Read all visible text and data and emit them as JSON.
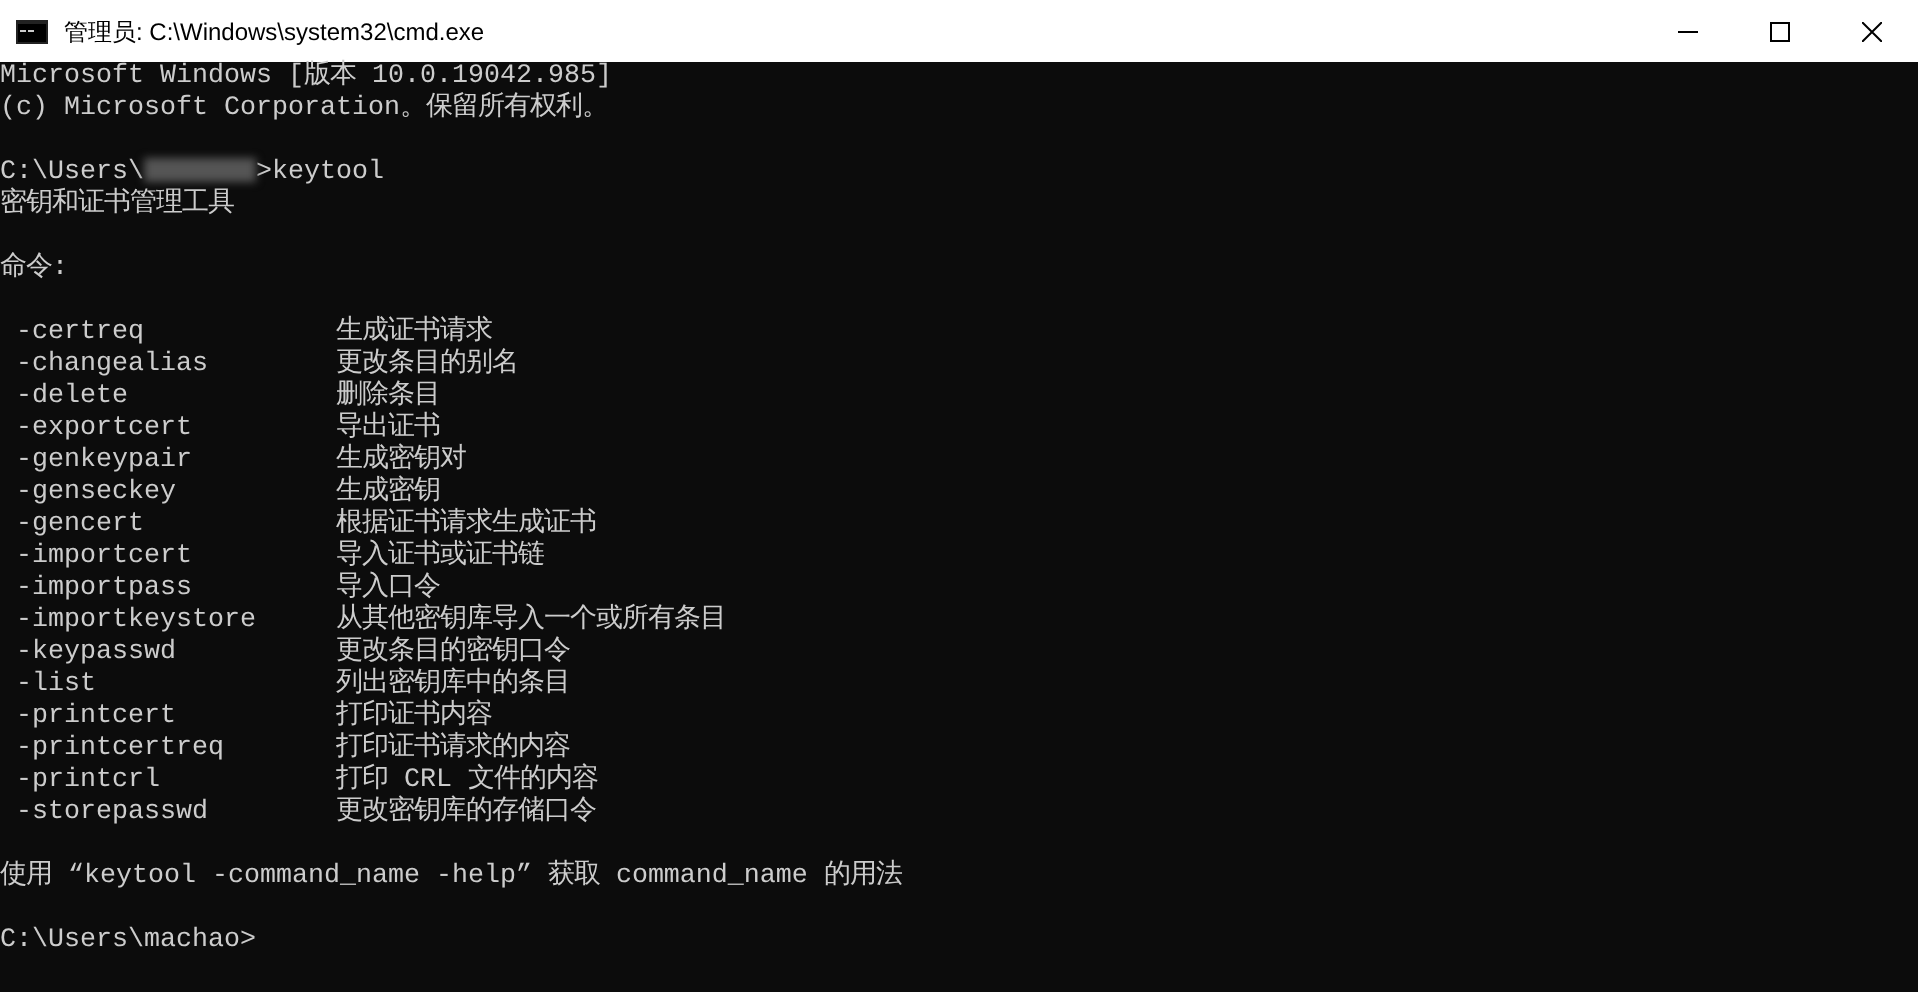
{
  "window": {
    "title": "管理员: C:\\Windows\\system32\\cmd.exe"
  },
  "console": {
    "header": [
      "Microsoft Windows [版本 10.0.19042.985]",
      "(c) Microsoft Corporation。保留所有权利。"
    ],
    "command_line": {
      "prompt_prefix": "C:\\Users\\",
      "command": ">keytool"
    },
    "tool_title": "密钥和证书管理工具",
    "commands_heading": "命令:",
    "commands": [
      {
        "name": "-certreq",
        "description": "生成证书请求"
      },
      {
        "name": "-changealias",
        "description": "更改条目的别名"
      },
      {
        "name": "-delete",
        "description": "删除条目"
      },
      {
        "name": "-exportcert",
        "description": "导出证书"
      },
      {
        "name": "-genkeypair",
        "description": "生成密钥对"
      },
      {
        "name": "-genseckey",
        "description": "生成密钥"
      },
      {
        "name": "-gencert",
        "description": "根据证书请求生成证书"
      },
      {
        "name": "-importcert",
        "description": "导入证书或证书链"
      },
      {
        "name": "-importpass",
        "description": "导入口令"
      },
      {
        "name": "-importkeystore",
        "description": "从其他密钥库导入一个或所有条目"
      },
      {
        "name": "-keypasswd",
        "description": "更改条目的密钥口令"
      },
      {
        "name": "-list",
        "description": "列出密钥库中的条目"
      },
      {
        "name": "-printcert",
        "description": "打印证书内容"
      },
      {
        "name": "-printcertreq",
        "description": "打印证书请求的内容"
      },
      {
        "name": "-printcrl",
        "description": "打印 CRL 文件的内容"
      },
      {
        "name": "-storepasswd",
        "description": "更改密钥库的存储口令"
      }
    ],
    "usage": "使用 “keytool -command_name -help” 获取 command_name 的用法",
    "prompt": "C:\\Users\\machao>"
  }
}
